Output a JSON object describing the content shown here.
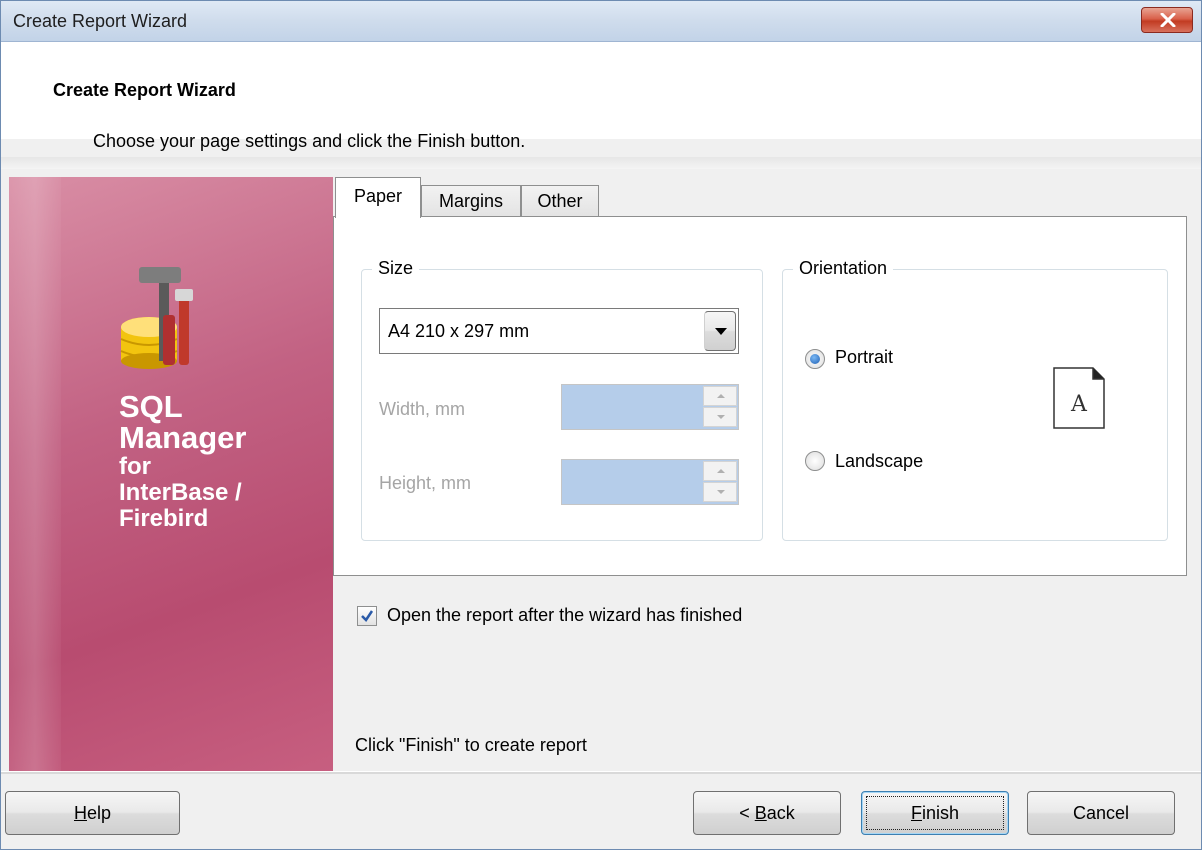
{
  "window": {
    "title": "Create Report Wizard",
    "close_icon": "close-icon"
  },
  "header": {
    "title": "Create Report Wizard",
    "subtitle": "Choose your page settings and click the Finish button."
  },
  "sidebar": {
    "brand_line1": "SQL",
    "brand_line2": "Manager",
    "brand_line3": "for",
    "brand_line4": "InterBase /",
    "brand_line5": "Firebird",
    "logo_icon": "database-tools-icon"
  },
  "tabs": [
    {
      "label": "Paper",
      "active": true
    },
    {
      "label": "Margins",
      "active": false
    },
    {
      "label": "Other",
      "active": false
    }
  ],
  "size": {
    "legend": "Size",
    "paper_value": "A4 210 x 297 mm",
    "width_label": "Width, mm",
    "height_label": "Height, mm"
  },
  "orientation": {
    "legend": "Orientation",
    "portrait_label": "Portrait",
    "landscape_label": "Landscape",
    "selected": "Portrait",
    "page_icon_letter": "A"
  },
  "options": {
    "open_report_label": "Open the report after the wizard has finished",
    "open_report_checked": true,
    "hint": "Click \"Finish\" to create report"
  },
  "buttons": {
    "help_prefix": "",
    "help_underline": "H",
    "help_rest": "elp",
    "back_prefix": "< ",
    "back_underline": "B",
    "back_rest": "ack",
    "finish_underline": "F",
    "finish_rest": "inish",
    "cancel": "Cancel"
  },
  "colors": {
    "sidebar_accent": "#c26283",
    "titlebar": "#cfdcec",
    "disabled_field": "#b5cdea"
  }
}
